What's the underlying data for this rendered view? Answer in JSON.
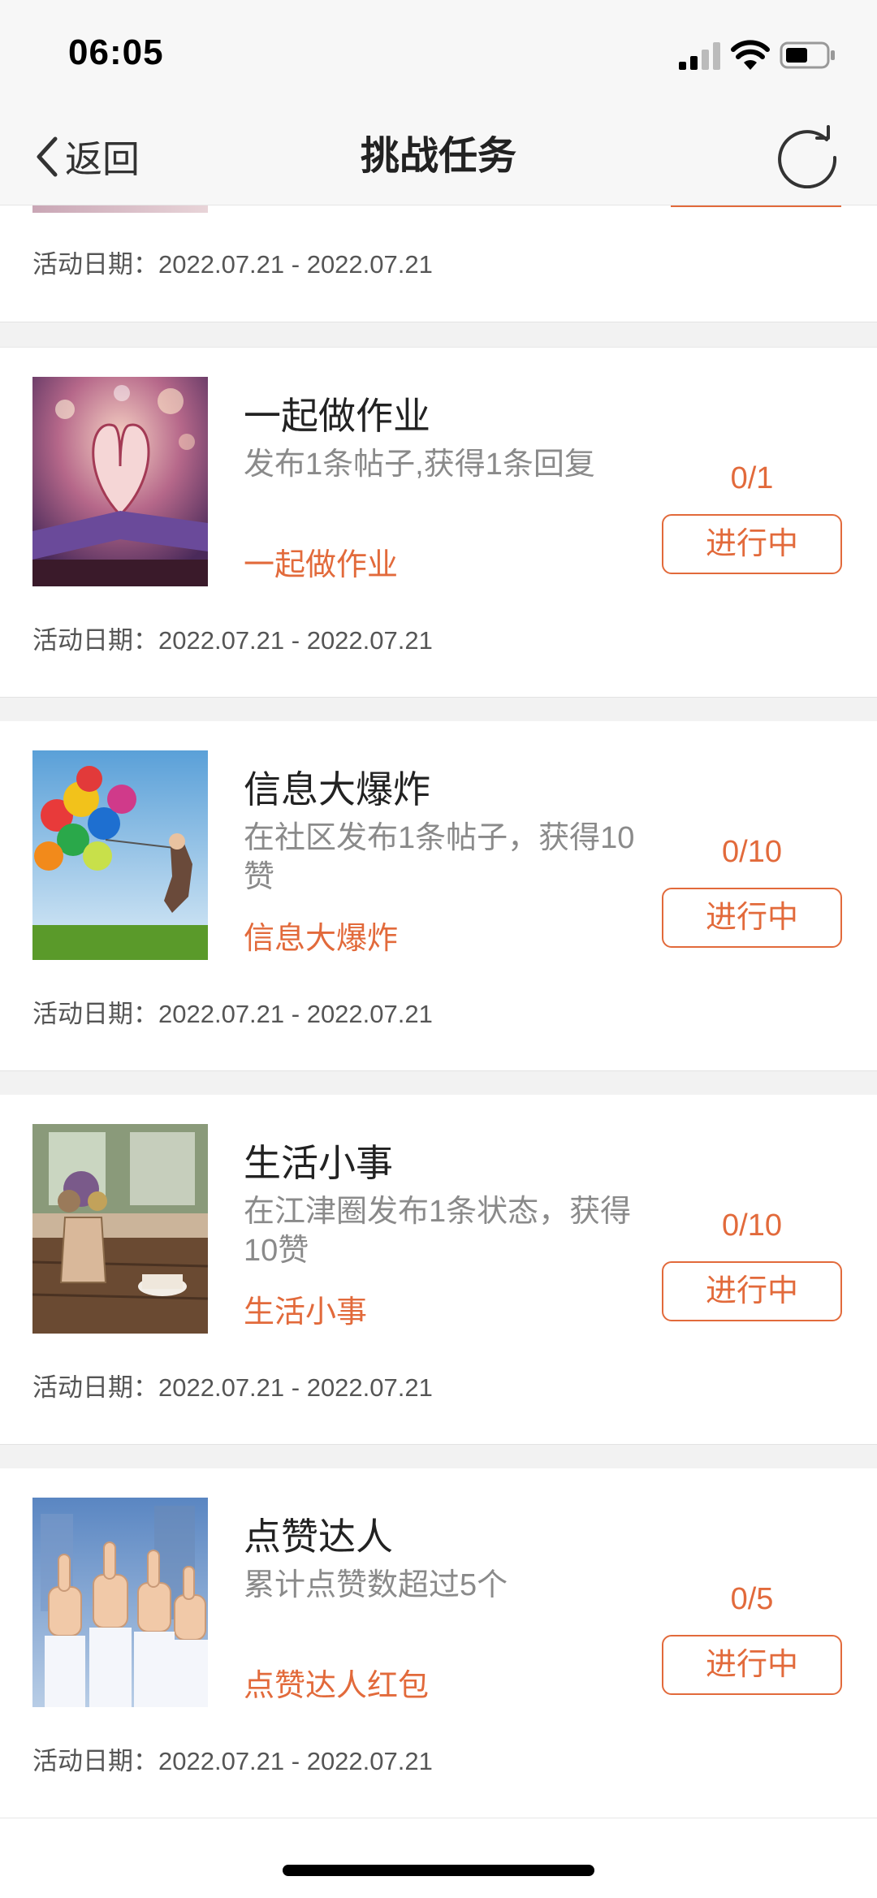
{
  "status_bar": {
    "time": "06:05"
  },
  "nav": {
    "back_label": "返回",
    "title": "挑战任务"
  },
  "colors": {
    "accent": "#e26a3b",
    "text": "#222222",
    "muted": "#8a8a8a",
    "separator": "#f2f2f2"
  },
  "first_card_tail": {
    "date_label": "活动日期：2022.07.21 - 2022.07.21"
  },
  "tasks": [
    {
      "title": "一起做作业",
      "description": "发布1条帖子,获得1条回复",
      "reward": "一起做作业",
      "progress": "0/1",
      "status": "进行中",
      "date_label": "活动日期：2022.07.21 - 2022.07.21",
      "image": "book-heart-image"
    },
    {
      "title": "信息大爆炸",
      "description": "在社区发布1条帖子，获得10赞",
      "reward": "信息大爆炸",
      "progress": "0/10",
      "status": "进行中",
      "date_label": "活动日期：2022.07.21 - 2022.07.21",
      "image": "balloons-image"
    },
    {
      "title": "生活小事",
      "description": "在江津圈发布1条状态，获得10赞",
      "reward": "生活小事",
      "progress": "0/10",
      "status": "进行中",
      "date_label": "活动日期：2022.07.21 - 2022.07.21",
      "image": "flower-vase-image"
    },
    {
      "title": "点赞达人",
      "description": "累计点赞数超过5个",
      "reward": "点赞达人红包",
      "progress": "0/5",
      "status": "进行中",
      "date_label": "活动日期：2022.07.21 - 2022.07.21",
      "image": "thumbs-up-image"
    }
  ]
}
